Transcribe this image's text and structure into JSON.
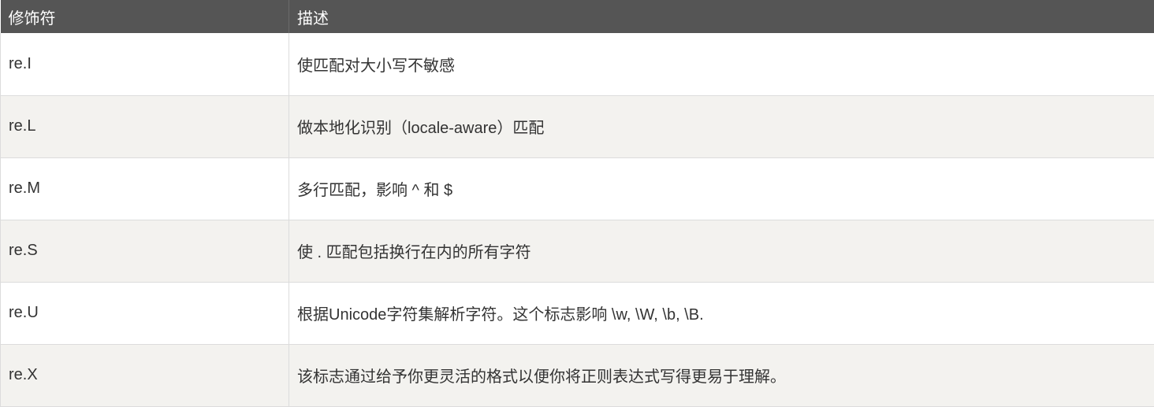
{
  "table": {
    "headers": [
      "修饰符",
      "描述"
    ],
    "rows": [
      {
        "modifier": "re.I",
        "description": "使匹配对大小写不敏感"
      },
      {
        "modifier": "re.L",
        "description": "做本地化识别（locale-aware）匹配"
      },
      {
        "modifier": "re.M",
        "description": "多行匹配，影响 ^ 和 $"
      },
      {
        "modifier": "re.S",
        "description": "使 . 匹配包括换行在内的所有字符"
      },
      {
        "modifier": "re.U",
        "description": "根据Unicode字符集解析字符。这个标志影响 \\w, \\W, \\b, \\B."
      },
      {
        "modifier": "re.X",
        "description": "该标志通过给予你更灵活的格式以便你将正则表达式写得更易于理解。"
      }
    ]
  }
}
